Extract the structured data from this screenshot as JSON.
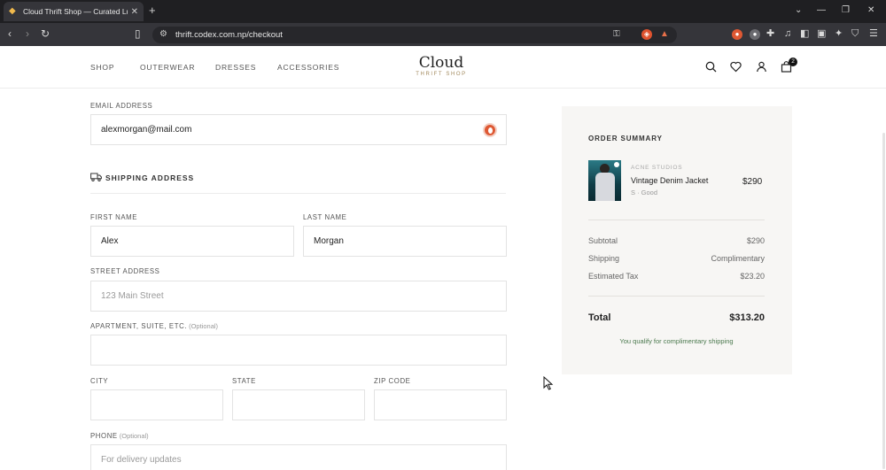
{
  "browser": {
    "tab_title": "Cloud Thrift Shop — Curated Lu",
    "url": "thrift.codex.com.np/checkout",
    "new_tab": "+",
    "close_tab": "✕"
  },
  "header": {
    "nav": [
      "SHOP",
      "OUTERWEAR",
      "DRESSES",
      "ACCESSORIES"
    ],
    "logo_main": "Cloud",
    "logo_sub": "THRIFT SHOP",
    "cart_count": "2"
  },
  "form": {
    "email_label": "EMAIL ADDRESS",
    "email_value": "alexmorgan@mail.com",
    "shipping_title": "SHIPPING ADDRESS",
    "first_name_label": "FIRST NAME",
    "first_name_value": "Alex",
    "last_name_label": "LAST NAME",
    "last_name_value": "Morgan",
    "street_label": "STREET ADDRESS",
    "street_placeholder": "123 Main Street",
    "apt_label": "APARTMENT, SUITE, ETC.",
    "apt_optional": "(Optional)",
    "city_label": "CITY",
    "state_label": "STATE",
    "zip_label": "ZIP CODE",
    "phone_label": "PHONE",
    "phone_optional": "(Optional)",
    "phone_placeholder": "For delivery updates"
  },
  "summary": {
    "title": "ORDER SUMMARY",
    "item": {
      "brand": "ACNE STUDIOS",
      "name": "Vintage Denim Jacket",
      "variant": "S · Good",
      "price": "$290"
    },
    "subtotal_label": "Subtotal",
    "subtotal_value": "$290",
    "shipping_label": "Shipping",
    "shipping_value": "Complimentary",
    "tax_label": "Estimated Tax",
    "tax_value": "$23.20",
    "total_label": "Total",
    "total_value": "$313.20",
    "note": "You qualify for complimentary shipping"
  },
  "colors": {
    "accent_gold": "#a38a5e",
    "note_green": "#4c7a4f",
    "summary_bg": "#f7f6f4"
  }
}
